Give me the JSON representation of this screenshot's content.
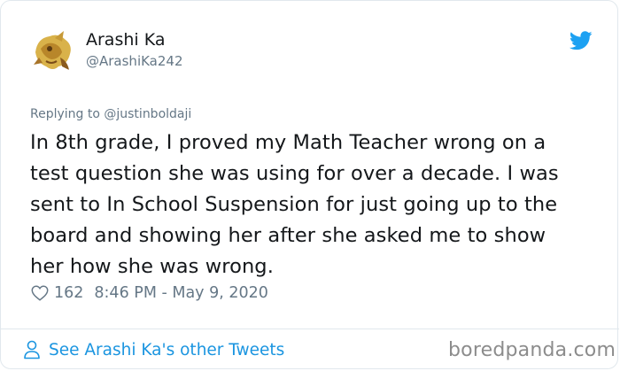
{
  "user": {
    "display_name": "Arashi Ka",
    "handle": "@ArashiKa242"
  },
  "icons": {
    "brand": "twitter-bird-icon",
    "like": "heart-icon",
    "profile": "person-icon"
  },
  "tweet": {
    "replying_to": "Replying to @justinboldaji",
    "text": "In 8th grade, I proved my Math Teacher wrong on a\ntest question she was using for over a decade. I was\nsent to In School Suspension for just going up to the\nboard and showing her after she asked me to show\nher how she was wrong.",
    "like_count": "162",
    "timestamp": "8:46 PM - May 9, 2020"
  },
  "footer": {
    "see_more": "See Arashi Ka's other Tweets",
    "watermark": "boredpanda.com"
  },
  "colors": {
    "link": "#1b95e0",
    "muted": "#657786",
    "text": "#14171a"
  }
}
